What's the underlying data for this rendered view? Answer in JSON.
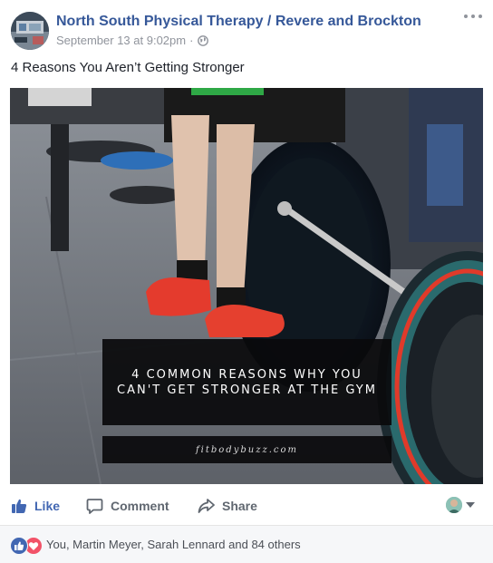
{
  "header": {
    "page_name": "North South Physical Therapy / Revere and Brockton",
    "timestamp": "September 13 at 9:02pm",
    "separator": "·",
    "privacy_icon": "globe-icon",
    "menu_icon": "more-options-icon"
  },
  "post": {
    "text": "4 Reasons You Aren’t Getting Stronger"
  },
  "image": {
    "overlay_title": "4 COMMON REASONS WHY YOU CAN'T GET STRONGER AT THE GYM",
    "overlay_domain": "fitbodybuzz.com"
  },
  "actions": {
    "like_label": "Like",
    "comment_label": "Comment",
    "share_label": "Share"
  },
  "reactions": {
    "icons": [
      "like-reaction-icon",
      "love-reaction-icon"
    ],
    "summary": "You, Martin Meyer, Sarah Lennard and 84 others"
  },
  "colors": {
    "brand_blue": "#4267b2",
    "link_blue": "#365899",
    "muted_gray": "#90949c",
    "love_red": "#f25268"
  }
}
